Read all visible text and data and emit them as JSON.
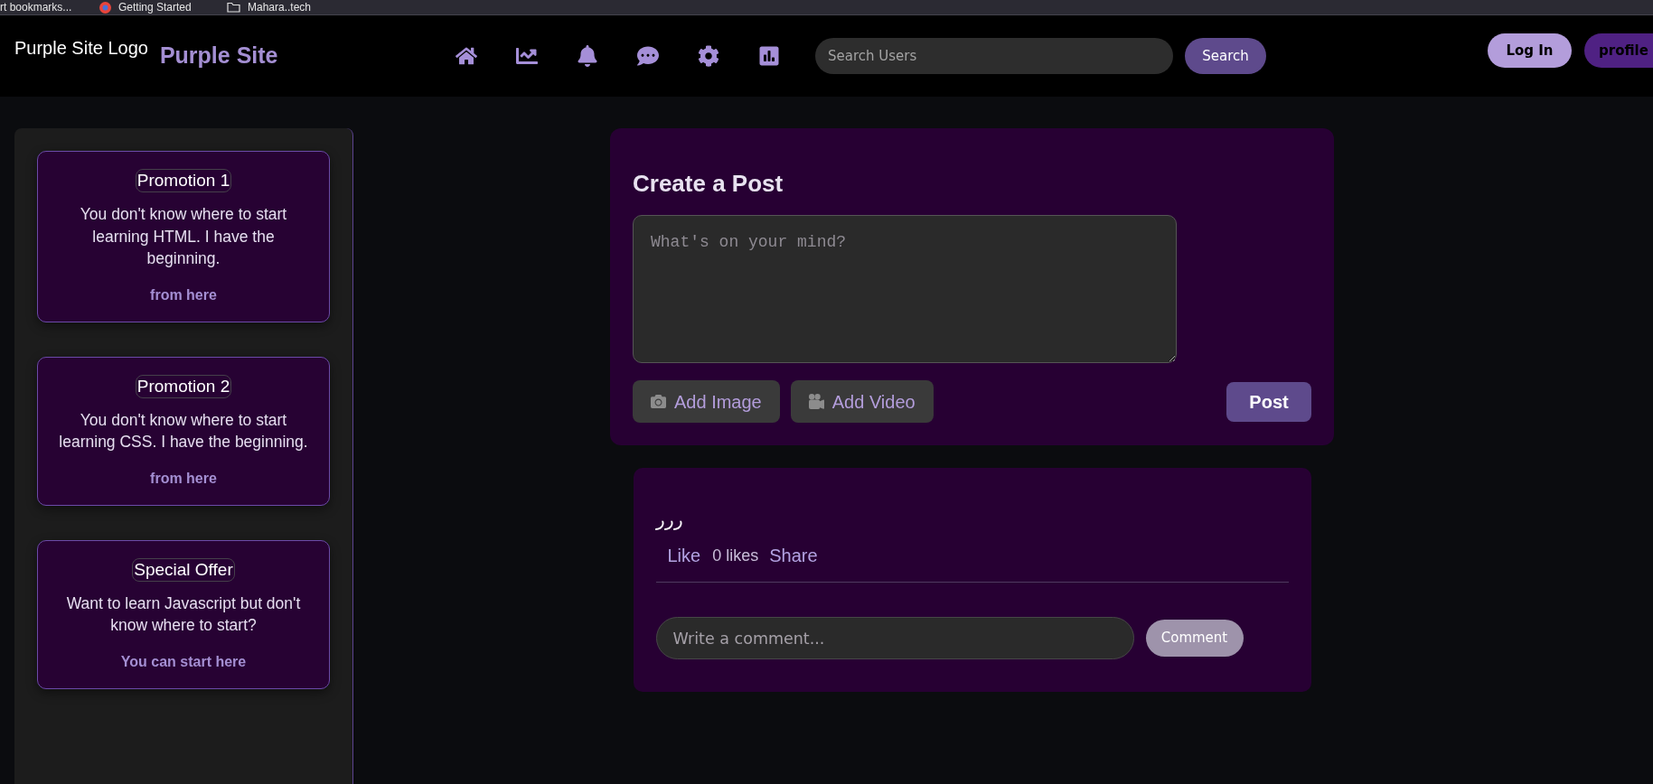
{
  "bookmarks_bar": [
    {
      "label": "rt bookmarks...",
      "kind": "plain"
    },
    {
      "label": "Getting Started",
      "kind": "site"
    },
    {
      "label": "Mahara..tech",
      "kind": "folder"
    }
  ],
  "header": {
    "logo_text": "Purple Site Logo",
    "site_name": "Purple Site",
    "search": {
      "placeholder": "Search Users",
      "button": "Search"
    },
    "login_button": "Log In",
    "profile_button": "profile"
  },
  "sidebar": {
    "promotions": [
      {
        "title": "Promotion 1",
        "text": "You don't know where to start learning HTML. I have the beginning.",
        "link": "from here"
      },
      {
        "title": "Promotion 2",
        "text": "You don't know where to start learning CSS. I have the beginning.",
        "link": "from here"
      },
      {
        "title": "Special Offer",
        "text": "Want to learn Javascript but don't know where to start?",
        "link": "You can start here"
      }
    ]
  },
  "create_post": {
    "title": "Create a Post",
    "placeholder": "What's on your mind?",
    "attachments": [
      {
        "kind": "image",
        "label": "Add Image"
      },
      {
        "kind": "video",
        "label": "Add Video"
      }
    ],
    "submit": "Post"
  },
  "posts": [
    {
      "text": "ررر",
      "like": "Like",
      "likes": "0 likes",
      "share": "Share",
      "comment_placeholder": "Write a comment...",
      "comment_button": "Comment"
    }
  ]
}
